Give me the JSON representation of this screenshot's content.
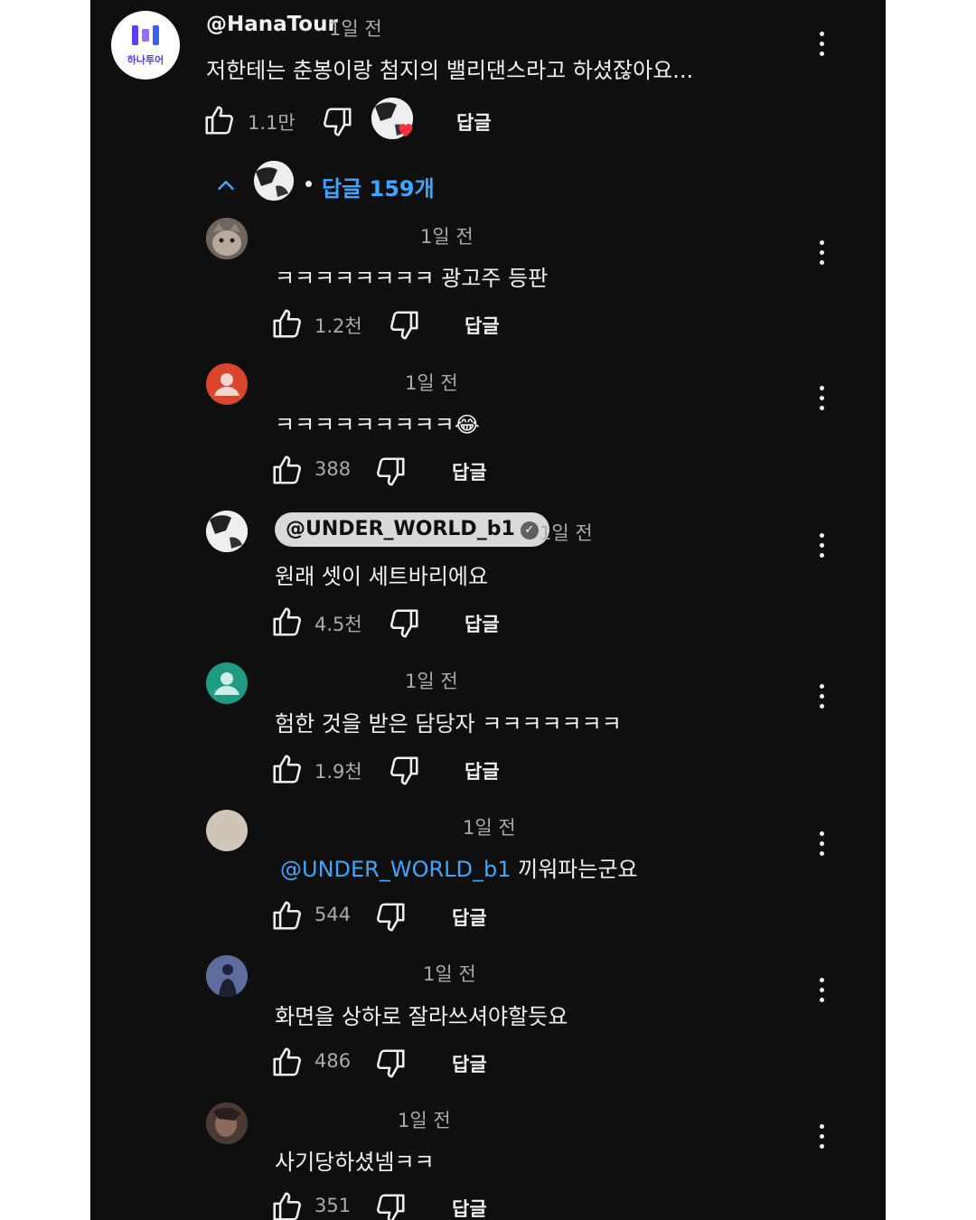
{
  "top_comment": {
    "channel_logo_text": "하나투어",
    "author": "@HanaTour",
    "time": "1일 전",
    "text": "저한테는 춘봉이랑 첨지의 밸리댄스라고 하셨잖아요...",
    "likes": "1.1만",
    "reply_label": "답글",
    "colors": {
      "logo_bg": "#ffffff",
      "logo_brand": "#6a3df0",
      "heart": "#ff3040"
    }
  },
  "replies_toggle": {
    "label": "답글 159개",
    "color": "#3ea6ff"
  },
  "replies": [
    {
      "author": "",
      "time": "1일 전",
      "text": "ㅋㅋㅋㅋㅋㅋㅋㅋ 광고주 등판",
      "likes": "1.2천",
      "reply_label": "답글",
      "avatar": "cat"
    },
    {
      "author": "",
      "time": "1일 전",
      "text": "ㅋㅋㅋㅋㅋㅋㅋㅋㅋ",
      "emoji": "😂",
      "likes": "388",
      "reply_label": "답글",
      "avatar": "default-orange"
    },
    {
      "author": "@UNDER_WORLD_b1",
      "verified": "✓",
      "time": "1일 전",
      "text": "원래 셋이 세트바리에요",
      "likes": "4.5천",
      "reply_label": "답글",
      "avatar": "cow"
    },
    {
      "author": "",
      "time": "1일 전",
      "text": "험한 것을 받은 담당자 ㅋㅋㅋㅋㅋㅋㅋ",
      "likes": "1.9천",
      "reply_label": "답글",
      "avatar": "default-teal"
    },
    {
      "author": "",
      "time": "1일 전",
      "mention": "@UNDER_WORLD_b1",
      "text": " 끼워파는군요",
      "likes": "544",
      "reply_label": "답글",
      "avatar": "beige"
    },
    {
      "author": "",
      "time": "1일 전",
      "text": "화면을 상하로 잘라쓰셔야할듯요",
      "likes": "486",
      "reply_label": "답글",
      "avatar": "person"
    },
    {
      "author": "",
      "time": "1일 전",
      "text": "사기당하셨넴ㅋㅋ",
      "likes": "351",
      "reply_label": "답글",
      "avatar": "photo"
    }
  ],
  "colors": {
    "background": "#0f0f0f",
    "text": "#f1f1f1",
    "secondary": "#aaaaaa",
    "link": "#3ea6ff"
  },
  "icons": [
    "like-icon",
    "dislike-icon",
    "more-vert-icon",
    "chevron-up-icon",
    "verified-icon",
    "heart-icon"
  ]
}
